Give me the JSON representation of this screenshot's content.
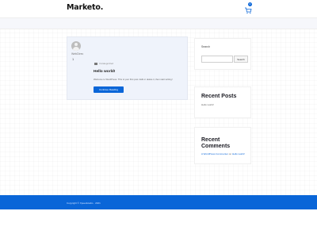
{
  "header": {
    "logo": "Marketo.",
    "cart_count": "0"
  },
  "post": {
    "author": "WebDirec",
    "comments": "1",
    "category": "Uncategorized",
    "title": "Hello world!",
    "excerpt": "Welcome to WordPress. This is your first post. Edit or delete it, then start writing!",
    "read_more": "Continue Reading"
  },
  "sidebar": {
    "search_label": "Search",
    "search_placeholder": "",
    "search_button": "Search",
    "recent_posts_title": "Recent Posts",
    "recent_post_link": "Hello world!",
    "recent_comments_title": "Recent Comments",
    "comment_author": "A WordPress Commenter",
    "comment_on": " on ",
    "comment_post": "Hello world!"
  },
  "footer": {
    "copyright": "Copyright © Xpeedstudio · 2021"
  },
  "colors": {
    "accent": "#0a66d8",
    "card_bg": "#eff3fb"
  }
}
